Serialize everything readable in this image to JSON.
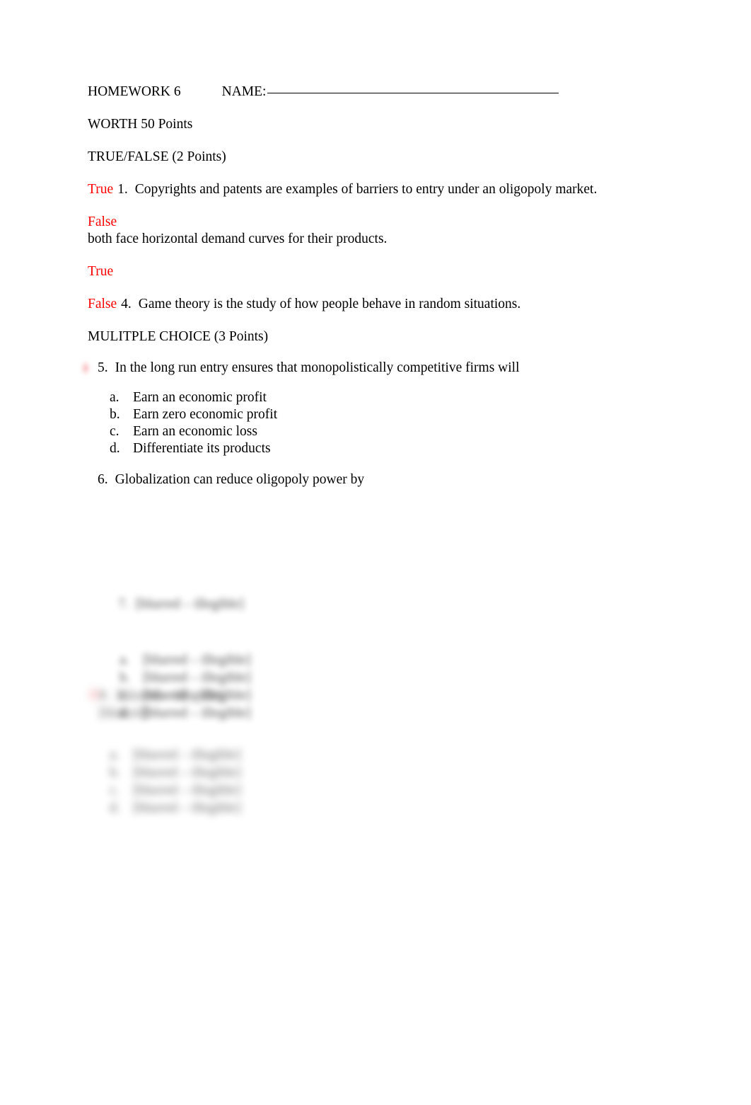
{
  "document": {
    "title": "HOMEWORK 6",
    "name_label": "NAME:",
    "name_value": "",
    "worth_line": "WORTH 50 Points",
    "accent_color": "#ff0000",
    "text_color": "#000000",
    "background_color": "#ffffff"
  },
  "true_false": {
    "heading": "TRUE/FALSE (2 Points)",
    "items": [
      {
        "answer": "True",
        "number": "1.",
        "text": "Copyrights and patents are examples of barriers to entry under an oligopoly market.",
        "layout": "inline"
      },
      {
        "answer": "False",
        "number": "",
        "text": "both face horizontal demand curves for their products.",
        "layout": "split"
      },
      {
        "answer": "True",
        "number": "",
        "text": "",
        "layout": "answer-only"
      },
      {
        "answer": "False",
        "number": "4.",
        "text": "Game theory is the study of how people behave in random situations.",
        "layout": "inline"
      }
    ]
  },
  "multiple_choice": {
    "heading": "MULITPLE CHOICE (3 Points)",
    "questions": [
      {
        "number": "5.",
        "text": "In the long run entry ensures that monopolistically competitive firms will",
        "has_answer_mark": true,
        "options": [
          {
            "marker": "a.",
            "text": "Earn an economic profit"
          },
          {
            "marker": "b.",
            "text": "Earn zero economic profit"
          },
          {
            "marker": "c.",
            "text": "Earn an economic loss"
          },
          {
            "marker": "d.",
            "text": "Differentiate its products"
          }
        ]
      },
      {
        "number": "6.",
        "text": "Globalization can reduce oligopoly power by",
        "has_answer_mark": false,
        "options": []
      }
    ]
  },
  "redacted": {
    "note": "blurred-illegible",
    "question_7": {
      "number": "7.",
      "text": "[blurred – illegible]",
      "options": [
        {
          "marker": "a.",
          "text": "[blurred – illegible]"
        },
        {
          "marker": "b.",
          "text": "[blurred – illegible]"
        },
        {
          "marker": "c.",
          "text": "[blurred – illegible]"
        },
        {
          "marker": "d.",
          "text": "[blurred – illegible]"
        }
      ]
    },
    "question_8": {
      "number": "8.",
      "text": "[blurred – illegible]",
      "text_line2": "[blurred]",
      "has_answer_mark": true,
      "options": [
        {
          "marker": "a.",
          "text": "[blurred – illegible]"
        },
        {
          "marker": "b.",
          "text": "[blurred – illegible]"
        },
        {
          "marker": "c.",
          "text": "[blurred – illegible]"
        },
        {
          "marker": "d.",
          "text": "[blurred – illegible]"
        }
      ]
    }
  }
}
